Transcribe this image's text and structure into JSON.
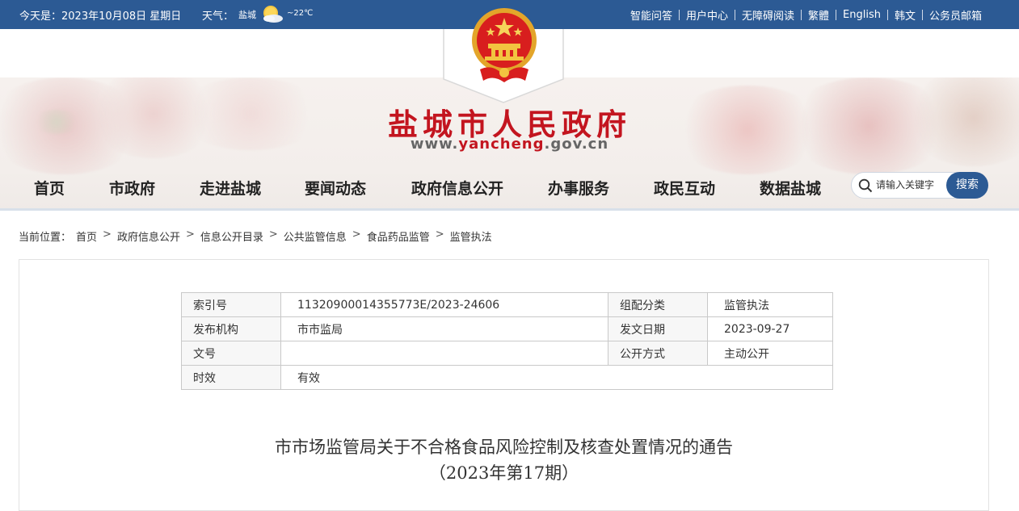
{
  "topbar": {
    "date": "今天是：2023年10月08日 星期日",
    "weather_label": "天气：",
    "weather_city": "盐城",
    "weather_temp": "~22℃",
    "weather_icon": "sun-cloud-icon",
    "links": [
      "智能问答",
      "用户中心",
      "无障碍阅读",
      "繁體",
      "English",
      "韩文",
      "公务员邮箱"
    ]
  },
  "header": {
    "site_name": "盐城市人民政府",
    "url_prefix": "www.",
    "url_mid": "yancheng",
    "url_suffix": ".gov.cn"
  },
  "nav": {
    "items": [
      "首页",
      "市政府",
      "走进盐城",
      "要闻动态",
      "政府信息公开",
      "办事服务",
      "政民互动",
      "数据盐城"
    ]
  },
  "search": {
    "placeholder": "请输入关键字",
    "button": "搜索"
  },
  "breadcrumb": {
    "label": "当前位置：",
    "items": [
      "首页",
      "政府信息公开",
      "信息公开目录",
      "公共监管信息",
      "食品药品监管",
      "监管执法"
    ]
  },
  "meta_table": {
    "rows": [
      {
        "k1": "索引号",
        "v1": "11320900014355773E/2023-24606",
        "k2": "组配分类",
        "v2": "监管执法"
      },
      {
        "k1": "发布机构",
        "v1": "市市监局",
        "k2": "发文日期",
        "v2": "2023-09-27"
      },
      {
        "k1": "文号",
        "v1": "",
        "k2": "公开方式",
        "v2": "主动公开"
      },
      {
        "k1": "时效",
        "v1": "有效"
      }
    ]
  },
  "article": {
    "title_line1": "市市场监管局关于不合格食品风险控制及核查处置情况的通告",
    "title_line2": "（2023年第17期）"
  },
  "colors": {
    "brand_blue": "#2c5a94",
    "title_red": "#c3151f"
  }
}
